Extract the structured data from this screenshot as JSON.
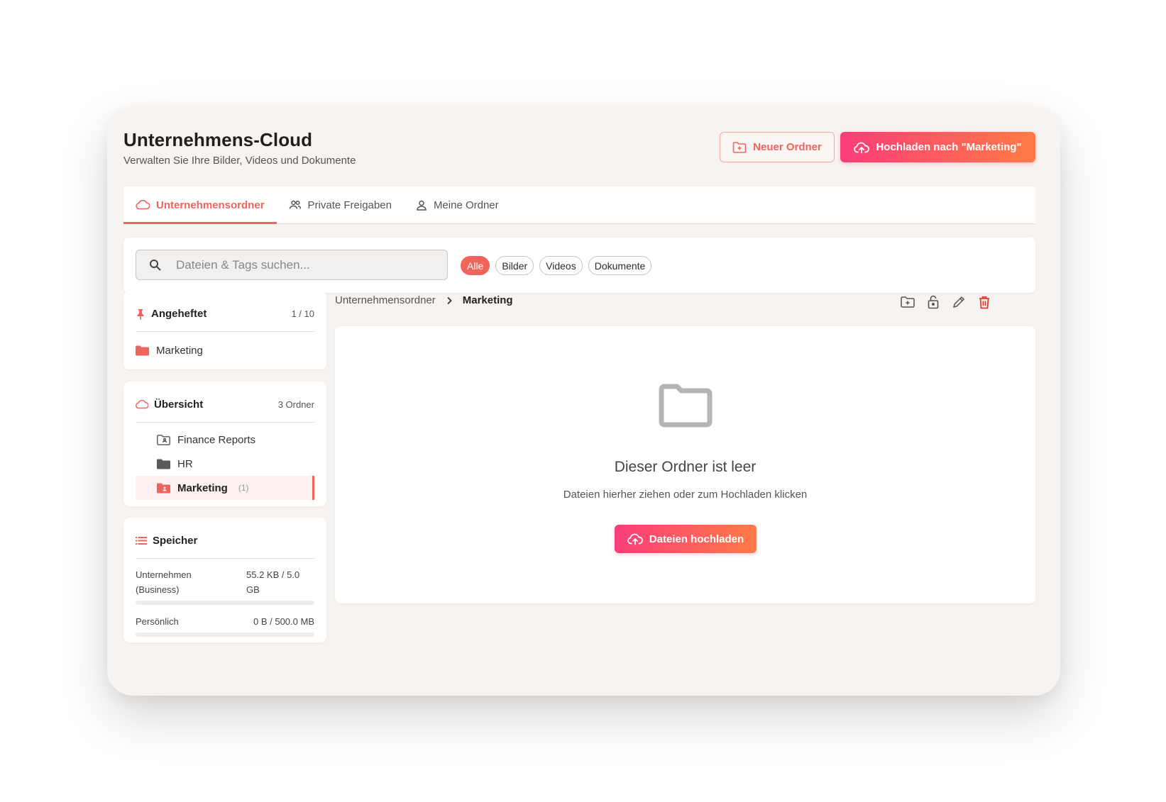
{
  "header": {
    "title": "Unternehmens-Cloud",
    "subtitle": "Verwalten Sie Ihre Bilder, Videos und Dokumente",
    "new_folder_label": "Neuer Ordner",
    "upload_label": "Hochladen nach \"Marketing\""
  },
  "tabs": [
    {
      "label": "Unternehmensordner",
      "icon": "cloud-icon",
      "active": true
    },
    {
      "label": "Private Freigaben",
      "icon": "users-icon",
      "active": false
    },
    {
      "label": "Meine Ordner",
      "icon": "user-icon",
      "active": false
    }
  ],
  "search": {
    "placeholder": "Dateien & Tags suchen..."
  },
  "filters": [
    {
      "label": "Alle",
      "active": true
    },
    {
      "label": "Bilder",
      "active": false
    },
    {
      "label": "Videos",
      "active": false
    },
    {
      "label": "Dokumente",
      "active": false
    }
  ],
  "pinned": {
    "title": "Angeheftet",
    "count": "1 / 10",
    "items": [
      {
        "label": "Marketing"
      }
    ]
  },
  "overview": {
    "title": "Übersicht",
    "count": "3 Ordner",
    "folders": [
      {
        "label": "Finance Reports",
        "icon": "shared-folder-icon",
        "selected": false
      },
      {
        "label": "HR",
        "icon": "folder-icon",
        "selected": false
      },
      {
        "label": "Marketing",
        "count": "(1)",
        "icon": "shared-folder-icon",
        "selected": true
      }
    ]
  },
  "storage": {
    "title": "Speicher",
    "rows": [
      {
        "label_line1": "Unternehmen",
        "label_line2": "(Business)",
        "value_line1": "55.2 KB / 5.0",
        "value_line2": "GB",
        "fraction": 0.0
      },
      {
        "label": "Persönlich",
        "value": "0 B / 500.0 MB",
        "fraction": 0.0
      }
    ]
  },
  "breadcrumb": {
    "root": "Unternehmensordner",
    "current": "Marketing"
  },
  "empty": {
    "title": "Dieser Ordner ist leer",
    "subtitle": "Dateien hierher ziehen oder zum Hochladen klicken",
    "button_label": "Dateien hochladen"
  },
  "colors": {
    "accent": "#f0645c",
    "gradient_start": "#fb3d7a",
    "gradient_end": "#ff7b45",
    "danger": "#e53935"
  }
}
